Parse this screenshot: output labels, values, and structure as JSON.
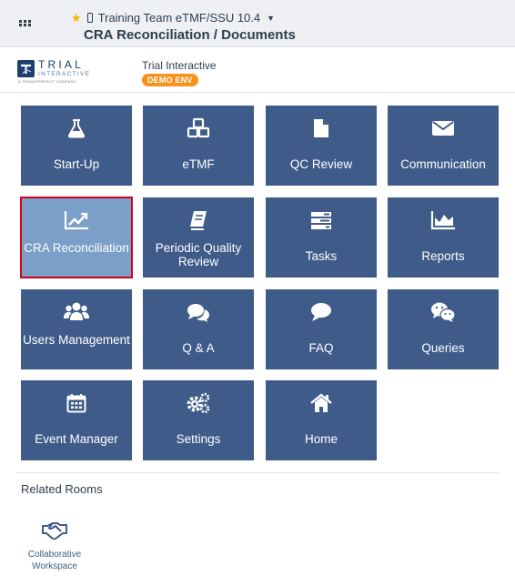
{
  "header": {
    "room_name": "Training Team eTMF/SSU 10.4",
    "page_title": "CRA Reconciliation / Documents",
    "favorite_color": "#f5b400"
  },
  "brand": {
    "name": "Trial Interactive",
    "env_badge": "DEMO ENV",
    "logo_main": "TRIAL",
    "logo_sub": "INTERACTIVE",
    "logo_tagline": "A TRANSPERFECT COMPANY",
    "badge_color": "#f6921e"
  },
  "tiles": [
    {
      "label": "Start-Up",
      "icon": "flask-icon"
    },
    {
      "label": "eTMF",
      "icon": "cubes-icon"
    },
    {
      "label": "QC Review",
      "icon": "file-icon"
    },
    {
      "label": "Communication",
      "icon": "envelope-icon"
    },
    {
      "label": "CRA Reconciliation",
      "icon": "trend-chart-icon",
      "active": true
    },
    {
      "label": "Periodic Quality Review",
      "icon": "book-icon"
    },
    {
      "label": "Tasks",
      "icon": "tasks-icon"
    },
    {
      "label": "Reports",
      "icon": "area-chart-icon"
    },
    {
      "label": "Users Management",
      "icon": "users-icon"
    },
    {
      "label": "Q & A",
      "icon": "comments-icon"
    },
    {
      "label": "FAQ",
      "icon": "comment-icon"
    },
    {
      "label": "Queries",
      "icon": "wechat-icon"
    },
    {
      "label": "Event Manager",
      "icon": "calendar-icon"
    },
    {
      "label": "Settings",
      "icon": "cogs-icon"
    },
    {
      "label": "Home",
      "icon": "home-icon"
    }
  ],
  "related": {
    "title": "Related Rooms",
    "rooms": [
      {
        "label": "Collaborative Workspace",
        "icon": "handshake-icon"
      }
    ]
  },
  "colors": {
    "tile": "#3e5b8a",
    "tile_active": "#7b9fc8",
    "active_border": "#d0021b",
    "text": "#2d3e50"
  }
}
